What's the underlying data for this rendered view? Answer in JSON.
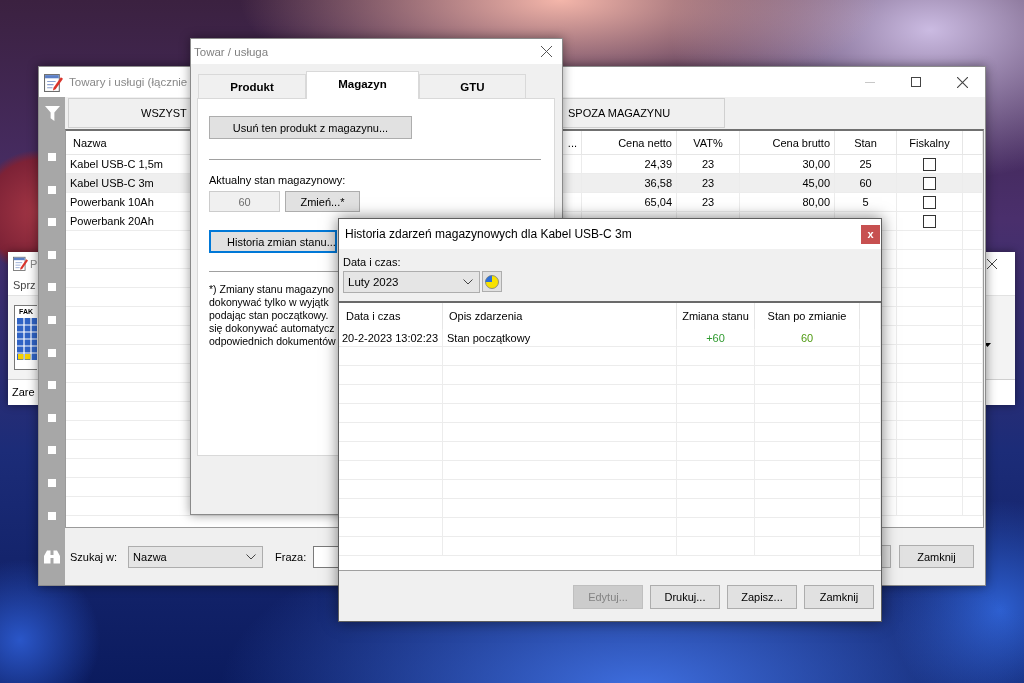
{
  "background_window": {
    "title": "P",
    "menu": [
      {
        "label": "Sprz"
      }
    ],
    "toolbar": [
      {
        "icon_text": "FAK",
        "label": "Zare"
      }
    ]
  },
  "products_window": {
    "title": "Towary i usługi (łącznie",
    "tabs": [
      {
        "label": "WSZYST"
      },
      {
        "label": "SPOZA MAGAZYNU"
      }
    ],
    "table": {
      "columns": [
        "Nazwa",
        "...",
        "Cena netto",
        "VAT%",
        "Cena brutto",
        "Stan",
        "Fiskalny"
      ],
      "rows": [
        {
          "selected": false,
          "name": "Kabel USB-C 1,5m",
          "net_price": "24,39",
          "vat": "23",
          "gross_price": "30,00",
          "stock": "25",
          "fiscal": false
        },
        {
          "selected": true,
          "name": "Kabel USB-C 3m",
          "net_price": "36,58",
          "vat": "23",
          "gross_price": "45,00",
          "stock": "60",
          "fiscal": false
        },
        {
          "selected": false,
          "name": "Powerbank 10Ah",
          "net_price": "65,04",
          "vat": "23",
          "gross_price": "80,00",
          "stock": "5",
          "fiscal": false
        },
        {
          "selected": false,
          "name": "Powerbank 20Ah",
          "fiscal": false
        }
      ]
    },
    "search": {
      "label": "Szukaj w:",
      "field": "Nazwa",
      "phrase_label": "Fraza:"
    },
    "close_button": "Zamknij"
  },
  "product_dialog": {
    "title": "Towar / usługa",
    "tabs": [
      {
        "label": "Produkt",
        "selected": false
      },
      {
        "label": "Magazyn",
        "selected": true
      },
      {
        "label": "GTU",
        "selected": false
      }
    ],
    "remove_button": "Usuń ten produkt z magazynu...",
    "stock_label": "Aktualny stan magazynowy:",
    "stock_field": {
      "value": "60",
      "disabled": true
    },
    "change_button": "Zmień...*",
    "history_button": {
      "label": "Historia zmian stanu...",
      "focused": true
    },
    "note_lines": [
      "*) Zmiany stanu magazyno",
      "dokonywać tylko w wyjątk",
      "podając stan początkowy.",
      "się dokonywać automatycz",
      "odpowiednich dokumentów"
    ]
  },
  "history_dialog": {
    "title": "Historia zdarzeń magazynowych dla Kabel USB-C 3m",
    "close_button": "x",
    "filter_label": "Data i czas:",
    "period": "Luty 2023",
    "table": {
      "columns": [
        "Data i czas",
        "Opis zdarzenia",
        "Zmiana stanu",
        "Stan po zmianie"
      ],
      "rows": [
        {
          "date": "20-2-2023 13:02:23",
          "description": "Stan początkowy",
          "change": "+60",
          "balance": "60"
        }
      ]
    },
    "buttons": [
      {
        "label": "Edytuj...",
        "disabled": true
      },
      {
        "label": "Drukuj...",
        "disabled": false
      },
      {
        "label": "Zapisz...",
        "disabled": false
      },
      {
        "label": "Zamknij",
        "disabled": false
      }
    ]
  }
}
